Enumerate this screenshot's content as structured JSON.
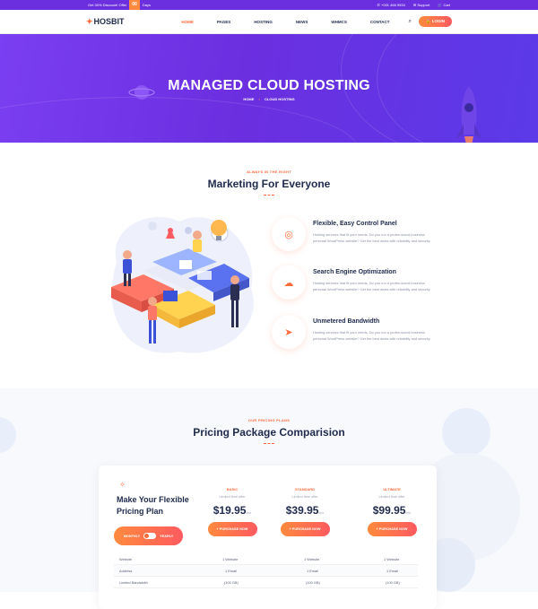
{
  "topbar": {
    "promo_text": "Get 30% Discount! Offer",
    "countdown": "00",
    "countdown_unit": "Days",
    "phone": "+001 466 9934",
    "support": "Support",
    "cart": "Cart"
  },
  "nav": {
    "logo": "HOSBIT",
    "items": [
      "HOME",
      "PAGES",
      "HOSTING",
      "NEWS",
      "WHMCS",
      "CONTACT"
    ],
    "active": "HOME",
    "login": "LOGIN"
  },
  "hero": {
    "title": "MANAGED CLOUD HOSTING",
    "crumb_home": "HOME",
    "crumb_sep": "•",
    "crumb_current": "CLOUD HOSTING"
  },
  "marketing": {
    "tag": "ALWAYS IN THE RIGHT",
    "title": "Marketing For Everyone",
    "features": [
      {
        "title": "Flexible, Easy Control Panel",
        "icon": "target-icon",
        "desc": "Hosting services that fit your needs. Do you run a profes-sional business personal WordPress website? Get the best deals with reliability and security."
      },
      {
        "title": "Search Engine Optimization",
        "icon": "cloud-icon",
        "desc": "Hosting services that fit your needs. Do you run a profes-sional business personal WordPress website? Get the best deals with reliability and security."
      },
      {
        "title": "Unmetered Bandwidth",
        "icon": "paper-plane-icon",
        "desc": "Hosting services that fit your needs. Do you run a profes-sional business personal WordPress website? Get the best deals with reliability and security."
      }
    ]
  },
  "pricing": {
    "tag": "OUR PRICING PLANS",
    "title": "Pricing Package Comparision",
    "card_title_line1": "Make Your Flexible",
    "card_title_line2": "Pricing Plan",
    "toggle_monthly": "MONTHLY",
    "toggle_yearly": "YEARLY",
    "plans": [
      {
        "name": "BASIC",
        "desc": "Limited time offer",
        "price": "$19.95",
        "per": "/mo",
        "button": "+ PURCHASE NOW"
      },
      {
        "name": "STANDARD",
        "desc": "Limited time offer",
        "price": "$39.95",
        "per": "/mo",
        "button": "+ PURCHASE NOW"
      },
      {
        "name": "ULTIMATE",
        "desc": "Limited time offer",
        "price": "$99.95",
        "per": "/mo",
        "button": "+ PURCHASE NOW"
      }
    ],
    "rows": [
      {
        "label": "Website",
        "values": [
          "1 Website",
          "1 Website",
          "1 Website"
        ]
      },
      {
        "label": "Address",
        "values": [
          "1 Email",
          "1 Email",
          "1 Email"
        ]
      },
      {
        "label": "Limited Bandwidth",
        "values": [
          "(100 GB)",
          "(100 GB)",
          "(100 GB)"
        ]
      }
    ]
  },
  "colors": {
    "brand_purple": "#6b2fe0",
    "accent_orange": "#ff6a3d",
    "navy": "#1f2a4d"
  }
}
